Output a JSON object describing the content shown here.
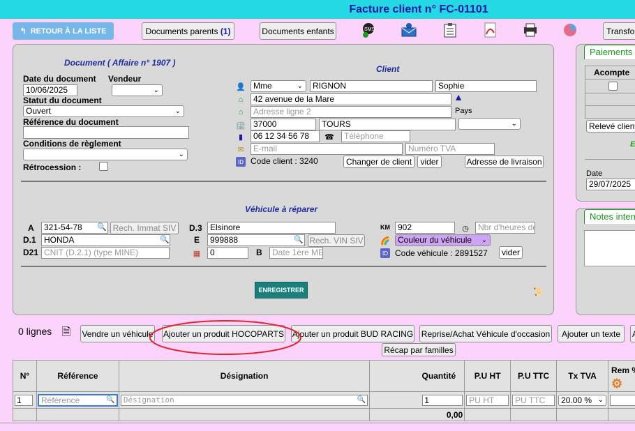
{
  "header": {
    "title": "Facture client n° FC-01101"
  },
  "toolbar": {
    "back": "RETOUR À LA LISTE",
    "parents": "Documents parents",
    "parents_count": "(1)",
    "children": "Documents enfants",
    "transform": "Transfor",
    "icons": [
      "sms-icon",
      "email-icon",
      "clipboard-icon",
      "pdf-icon",
      "print-icon",
      "chart-icon"
    ]
  },
  "document": {
    "section_title": "Document ( Affaire n° 1907 )",
    "date_label": "Date du document",
    "date_value": "10/06/2025",
    "vendeur_label": "Vendeur",
    "statut_label": "Statut du document",
    "statut_value": "Ouvert",
    "reference_label": "Référence du document",
    "conditions_label": "Conditions de règlement",
    "retro_label": "Rétrocession :"
  },
  "client": {
    "section_title": "Client",
    "civility": "Mme",
    "lastname": "RIGNON",
    "firstname": "Sophie",
    "address1": "42 avenue de la Mare",
    "address2_ph": "Adresse ligne 2",
    "pays_label": "Pays",
    "postcode": "37000",
    "city": "TOURS",
    "mobile": "06 12 34 56 78",
    "phone_ph": "Téléphone",
    "email_ph": "E-mail",
    "tva_ph": "Numéro TVA",
    "code_label": "Code client : 3240",
    "change_btn": "Changer de client",
    "clear_btn": "vider",
    "delivery_btn": "Adresse de livraison"
  },
  "vehicle": {
    "section_title": "Véhicule à réparer",
    "a_label": "A",
    "a_value": "321-54-78",
    "immat_btn": "Rech. Immat SIV",
    "d1_label": "D.1",
    "d1_value": "HONDA",
    "d21_label": "D21",
    "d21_ph": "CNIT (D.2.1) (type MINE)",
    "d3_label": "D.3",
    "d3_value": "Elsinore",
    "e_label": "E",
    "e_value": "999888",
    "vin_btn": "Rech. VIN SIV",
    "km_value_zero": "0",
    "b_label": "B",
    "b_ph": "Date 1ère ME",
    "km_label": "KM",
    "km_value": "902",
    "hours_ph": "Nbr d'heures de",
    "color_value": "Couleur du véhicule",
    "code_label": "Code véhicule : 2891527",
    "clear_btn": "vider"
  },
  "save_btn": "ENREGISTRER",
  "payments": {
    "title": "Paiements",
    "col_acompte": "Acompte",
    "releve_btn": "Relevé client",
    "e_letter": "E",
    "date_label": "Date",
    "date_value": "29/07/2025"
  },
  "notes": {
    "title": "Notes intern"
  },
  "lines": {
    "count": "0 lignes",
    "buttons": [
      "Vendre un véhicule",
      "Ajouter un produit HOCOPARTS",
      "Ajouter un produit BUD RACING",
      "Reprise/Achat Véhicule d'occasion",
      "Ajouter un texte",
      "A"
    ],
    "recap_btn": "Récap par familles"
  },
  "table": {
    "headers": [
      "N°",
      "Référence",
      "Désignation",
      "Quantité",
      "P.U HT",
      "P.U TTC",
      "Tx TVA",
      "Rem %"
    ],
    "row": {
      "num": "1",
      "ref_ph": "Référence",
      "des_ph": "Désignation",
      "qty": "1",
      "puht_ph": "PU HT",
      "puttc_ph": "PU TTC",
      "tva": "20.00 %"
    },
    "total_qty": "0,00"
  },
  "colors": {
    "topbar": "#24d9e4",
    "title": "#1a19a6",
    "background": "#fbd3fb",
    "panel": "#d9d9d9",
    "save": "#1b7f7c",
    "accent_green": "#1c9a1c",
    "highlight_circle": "#e0262d"
  }
}
